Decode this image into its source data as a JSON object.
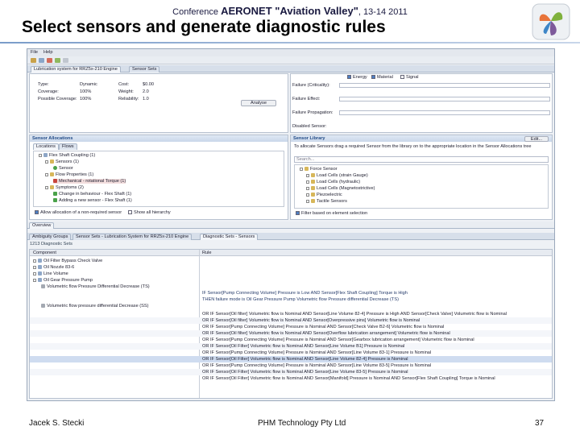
{
  "slide": {
    "conference_prefix": "Conference",
    "conference_name": "AERONET \"Aviation Valley\"",
    "conference_dates": ", 13-14 2011",
    "title": "Select sensors and generate diagnostic rules",
    "author": "Jacek S. Stecki",
    "company": "PHM Technology Pty Ltd",
    "page_number": "37"
  },
  "colors": {
    "title_rule": "#7a9cc9",
    "section_head": "#214a86",
    "highlight": "#cfdcf0"
  },
  "app": {
    "menu": [
      "File",
      "Help"
    ],
    "top_tabs": [
      "Lubrication system for RRZ5x-210 Engine",
      "Sensor Sets"
    ],
    "stats": {
      "type_label": "Type:",
      "type_value": "Dynamic",
      "coverage_label": "Coverage:",
      "coverage_value": "100%",
      "possible_label": "Possible Coverage:",
      "possible_value": "100%",
      "cost_label": "Cost:",
      "cost_value": "$0.00",
      "weight_label": "Weight:",
      "weight_value": "2.0",
      "reliability_label": "Reliability:",
      "reliability_value": "1.0",
      "analyse_button": "Analyse"
    },
    "filter_options": [
      "Energy",
      "Material",
      "Signal"
    ],
    "right_form": [
      "Failure (Criticality):",
      "Failure Effect:",
      "Failure Propagation:",
      "Disabled Sensor:"
    ],
    "sensor_allocations": {
      "title": "Sensor Allocations",
      "tabs": [
        "Locations",
        "Flows"
      ],
      "tree": [
        "Flex Shaft Coupling (1)",
        "Sensors (1)",
        "Sensor",
        "Flow Properties (1)",
        "Mechanical - rotational Torque (1)",
        "Symptoms (2)",
        "Change in behaviour - Flex Shaft (1)",
        "Adding a new sensor - Flex Shaft (1)"
      ],
      "allow_label": "Allow allocation of a non-required sensor",
      "show_all_label": "Show all hierarchy"
    },
    "sensor_library": {
      "title": "Sensor Library",
      "edit_button": "Edit...",
      "instruction": "To allocate Sensors drag a required Sensor from the library on to the appropriate location in the Sensor Allocations tree",
      "search_placeholder": "Search...",
      "tree": [
        "Force Sensor",
        "Load Cells (strain Gauge)",
        "Load Cells (hydraulic)",
        "Load Cells (Magnetostrictive)",
        "Piezoelectric",
        "Tactile Sensors"
      ],
      "filter_label": "Filter based on element selection"
    },
    "overview_tab": "Overview",
    "bottom_tabs": [
      "Ambiguity Groups",
      "Sensor Sets - Lubrication System for RRZ5x-210 Engine",
      "Diagnostic Sets - Sensors"
    ],
    "diag_set_label": "1213 Diagnostic Sets",
    "table": {
      "col_component": "Component",
      "col_rule": "Rule",
      "components": [
        "Oil Filter Bypass Check Valve",
        "Oil Nozzle 83-6",
        "Line Volume",
        "Oil Gear Pressure Pump",
        "Volumetric flow Pressure Differential Decrease (TS)",
        "Volumetric flow pressure differential Decrease (SS)"
      ],
      "rules": [
        "IF Sensor[Pump Connecting Volume] Pressure is Low AND Sensor[Flex Shaft Coupling] Torque is High",
        "THEN failure mode is Oil Gear Pressure Pump Volumetric flow Pressure differential Decrease (TS)",
        "OR IF Sensor[Oil filter] Volumetric flow is Nominal AND Sensor[Line Volume 82-4] Pressure is High AND Sensor[Check Valve] Volumetric flow is Nominal",
        "OR IF Sensor[Oil filter] Volumetric flow is Nominal AND Sensor[Overpressive pins] Volumetric flow is Nominal",
        "OR IF Sensor[Pump Connecting Volume] Pressure is Nominal AND Sensor[Check Valve B2-6] Volumetric flow is Nominal",
        "OR IF Sensor[Oil filter] Volumetric flow is Nominal AND Sensor[Overflow lubrication arrangement] Volumetric flow is Nominal",
        "OR IF Sensor[Pump Connecting Volume] Pressure is Nominal AND Sensor[Gearbox lubrication arrangement] Volumetric flow is Nominal",
        "OR IF Sensor[Oil Filter] Volumetric flow is Nominal AND Sensor[Line Volume B1] Pressure is Nominal",
        "OR IF Sensor[Pump Connecting Volume] Pressure is Nominal AND Sensor[Line Volume 83-1] Pressure is Nominal",
        "OR IF Sensor[Oil Filter] Volumetric flow is Nominal AND Sensor[Line Volume 82-4] Pressure is Nominal",
        "OR IF Sensor[Pump Connecting Volume] Pressure is Nominal AND Sensor[Line Volume 83-5] Pressure is Nominal",
        "OR IF Sensor[Oil Filter] Volumetric flow is Nominal AND Sensor[Line Volume 83-5] Pressure is Nominal",
        "OR IF Sensor[Oil Filter] Volumetric flow is Nominal AND Sensor[Manifold] Pressure is Nominal AND Sensor[Flex Shaft Coupling] Torque is Nominal"
      ]
    }
  }
}
